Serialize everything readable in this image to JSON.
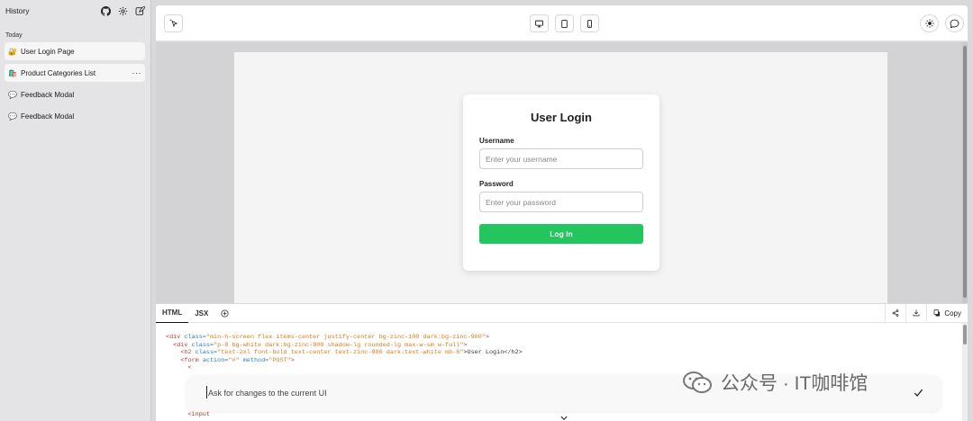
{
  "sidebar": {
    "title": "History",
    "section": "Today",
    "items": [
      {
        "emoji": "🔐",
        "label": "User Login Page"
      },
      {
        "emoji": "🛍️",
        "label": "Product Categories List",
        "more": "···"
      },
      {
        "emoji": "💬",
        "label": "Feedback Modal"
      },
      {
        "emoji": "💬",
        "label": "Feedback Modal"
      }
    ]
  },
  "toolbar": {
    "select_icon": "cursor-select-icon",
    "devices": [
      "desktop-icon",
      "tablet-icon",
      "mobile-icon"
    ],
    "right": [
      "sun-icon",
      "chat-icon"
    ]
  },
  "preview": {
    "card": {
      "title": "User Login",
      "username_label": "Username",
      "username_placeholder": "Enter your username",
      "password_label": "Password",
      "password_placeholder": "Enter your password",
      "button": "Log In",
      "button_color": "#22c55e"
    }
  },
  "code_panel": {
    "tabs": [
      "HTML",
      "JSX"
    ],
    "copy_label": "Copy",
    "lines": [
      {
        "tag_open": "<div ",
        "attr1": "class=",
        "val1": "\"min-h-screen flex items-center justify-center bg-zinc-100 dark:bg-zinc-900\"",
        "tail": ">"
      },
      {
        "tag_open": "<div ",
        "attr1": "class=",
        "val1": "\"p-8 bg-white dark:bg-zinc-800 shadow-lg rounded-lg max-w-sm w-full\"",
        "tail": ">"
      },
      {
        "tag_open": "<h2 ",
        "attr1": "class=",
        "val1": "\"text-2xl font-bold text-center text-zinc-800 dark:text-white mb-6\"",
        "tail": ">User Login</h2>"
      },
      {
        "tag_open": "<form ",
        "attr1": "action=",
        "val1": "\"#\"",
        "attr2": " method=",
        "val2": "\"POST\"",
        "tail": ">"
      },
      {
        "tag_open": "<",
        "tail": ""
      }
    ],
    "bottom_line": "<input"
  },
  "chat": {
    "placeholder": "Ask for changes to the current UI"
  },
  "watermark": {
    "text": "公众号 · IT咖啡馆"
  }
}
